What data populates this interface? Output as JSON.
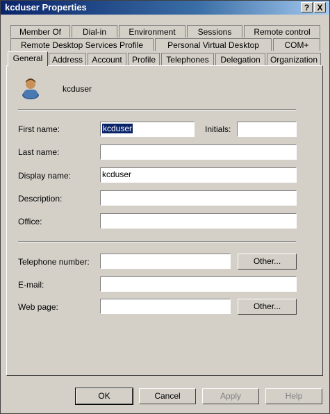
{
  "window": {
    "title": "kcduser Properties"
  },
  "titlebar_buttons": {
    "help": "?",
    "close": "X"
  },
  "tabs_row1": [
    "Member Of",
    "Dial-in",
    "Environment",
    "Sessions",
    "Remote control"
  ],
  "tabs_row2": [
    "Remote Desktop Services Profile",
    "Personal Virtual Desktop",
    "COM+"
  ],
  "tabs_row3": [
    "General",
    "Address",
    "Account",
    "Profile",
    "Telephones",
    "Delegation",
    "Organization"
  ],
  "header": {
    "username": "kcduser",
    "icon": "user-icon"
  },
  "fields": {
    "first_name": {
      "label": "First name:",
      "value": "kcduser"
    },
    "initials": {
      "label": "Initials:",
      "value": ""
    },
    "last_name": {
      "label": "Last name:",
      "value": ""
    },
    "display_name": {
      "label": "Display name:",
      "value": "kcduser"
    },
    "description": {
      "label": "Description:",
      "value": ""
    },
    "office": {
      "label": "Office:",
      "value": ""
    },
    "telephone": {
      "label": "Telephone number:",
      "value": "",
      "other_label": "Other..."
    },
    "email": {
      "label": "E-mail:",
      "value": ""
    },
    "web_page": {
      "label": "Web page:",
      "value": "",
      "other_label": "Other..."
    }
  },
  "buttons": {
    "ok": "OK",
    "cancel": "Cancel",
    "apply": "Apply",
    "help": "Help"
  }
}
